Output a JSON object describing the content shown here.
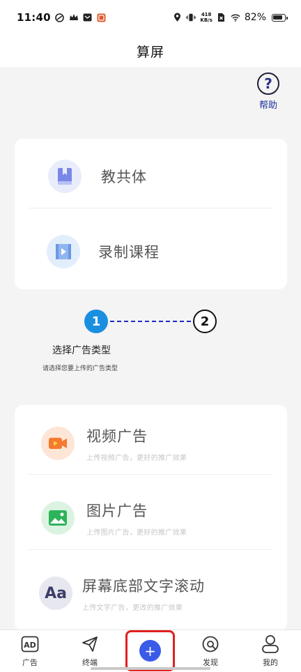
{
  "status_bar": {
    "time": "11:40",
    "net_speed_value": "418",
    "net_speed_unit": "KB/s",
    "battery": "82%"
  },
  "header": {
    "title": "算屏"
  },
  "help": {
    "label": "帮助",
    "glyph": "?"
  },
  "top_card": {
    "items": [
      {
        "label": "教共体",
        "icon": "book-icon"
      },
      {
        "label": "录制课程",
        "icon": "video-file-icon"
      }
    ]
  },
  "steps": {
    "step1": "1",
    "step2": "2",
    "label": "选择广告类型",
    "desc": "请选择您要上传的广告类型"
  },
  "ad_types": {
    "items": [
      {
        "title": "视频广告",
        "subtitle": "上传视频广告，更好的推广效果",
        "icon": "video-camera-icon",
        "color": "#f47a32"
      },
      {
        "title": "图片广告",
        "subtitle": "上传图片广告，更好的推广效果",
        "icon": "image-icon",
        "color": "#2db35a"
      },
      {
        "title": "屏幕底部文字滚动",
        "subtitle": "上传文字广告，更改的推广效果",
        "icon": "text-aa-icon",
        "color": "#3d3d6b"
      }
    ]
  },
  "bottom_nav": {
    "items": [
      {
        "label": "广告",
        "icon": "ad-icon"
      },
      {
        "label": "终端",
        "icon": "send-icon"
      },
      {
        "label": "",
        "icon": "add-icon"
      },
      {
        "label": "发现",
        "icon": "discover-icon"
      },
      {
        "label": "我的",
        "icon": "user-icon"
      }
    ],
    "add_glyph": "+"
  }
}
